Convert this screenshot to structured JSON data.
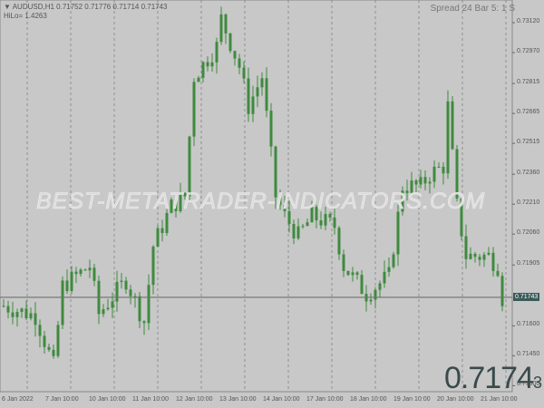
{
  "header": {
    "symbol_info": "▼ AUDUSD,H1  0.71752 0.71776 0.71714 0.71743",
    "hilo": "HiLo= 1.4263",
    "spread": "Spread 24  Bar 5: 1 S"
  },
  "watermark": "BEST-METATRADER-INDICATORS.COM",
  "big_price": {
    "main": "0.7174",
    "small": "3"
  },
  "colors": {
    "bg": "#c8c8c8",
    "candle": "#3f8a3f",
    "grid": "#888888",
    "current_line": "#707070",
    "current_box": "#3a5a5a"
  },
  "chart_data": {
    "type": "candlestick",
    "symbol": "AUDUSD",
    "timeframe": "H1",
    "current_price": "0.71743",
    "y_ticks": [
      "0.73120",
      "0.72970",
      "0.72815",
      "0.72665",
      "0.72515",
      "0.72360",
      "0.72210",
      "0.72060",
      "0.71905",
      "0.71600",
      "0.71450",
      "0.71300"
    ],
    "x_ticks": [
      "6 Jan 2022",
      "7 Jan 10:00",
      "10 Jan 10:00",
      "11 Jan 10:00",
      "12 Jan 10:00",
      "13 Jan 10:00",
      "14 Jan 10:00",
      "17 Jan 10:00",
      "18 Jan 10:00",
      "19 Jan 10:00",
      "20 Jan 10:00",
      "21 Jan 10:00"
    ],
    "ylim": [
      0.7128,
      0.7325
    ],
    "approx_close_path": [
      [
        0,
        0.717
      ],
      [
        7,
        0.7165
      ],
      [
        11,
        0.714
      ],
      [
        13,
        0.718
      ],
      [
        19,
        0.719
      ],
      [
        21,
        0.7166
      ],
      [
        27,
        0.7183
      ],
      [
        31,
        0.7162
      ],
      [
        33,
        0.72
      ],
      [
        37,
        0.722
      ],
      [
        40,
        0.7225
      ],
      [
        42,
        0.7285
      ],
      [
        47,
        0.73
      ],
      [
        48,
        0.7314
      ],
      [
        52,
        0.729
      ],
      [
        54,
        0.727
      ],
      [
        57,
        0.7285
      ],
      [
        60,
        0.7225
      ],
      [
        62,
        0.7215
      ],
      [
        65,
        0.7205
      ],
      [
        68,
        0.7215
      ],
      [
        73,
        0.721
      ],
      [
        75,
        0.719
      ],
      [
        80,
        0.7176
      ],
      [
        85,
        0.7185
      ],
      [
        88,
        0.723
      ],
      [
        92,
        0.723
      ],
      [
        94,
        0.7236
      ],
      [
        97,
        0.724
      ],
      [
        98,
        0.727
      ],
      [
        100,
        0.722
      ],
      [
        102,
        0.7195
      ],
      [
        107,
        0.7195
      ],
      [
        109,
        0.719
      ],
      [
        110,
        0.7174
      ]
    ]
  }
}
